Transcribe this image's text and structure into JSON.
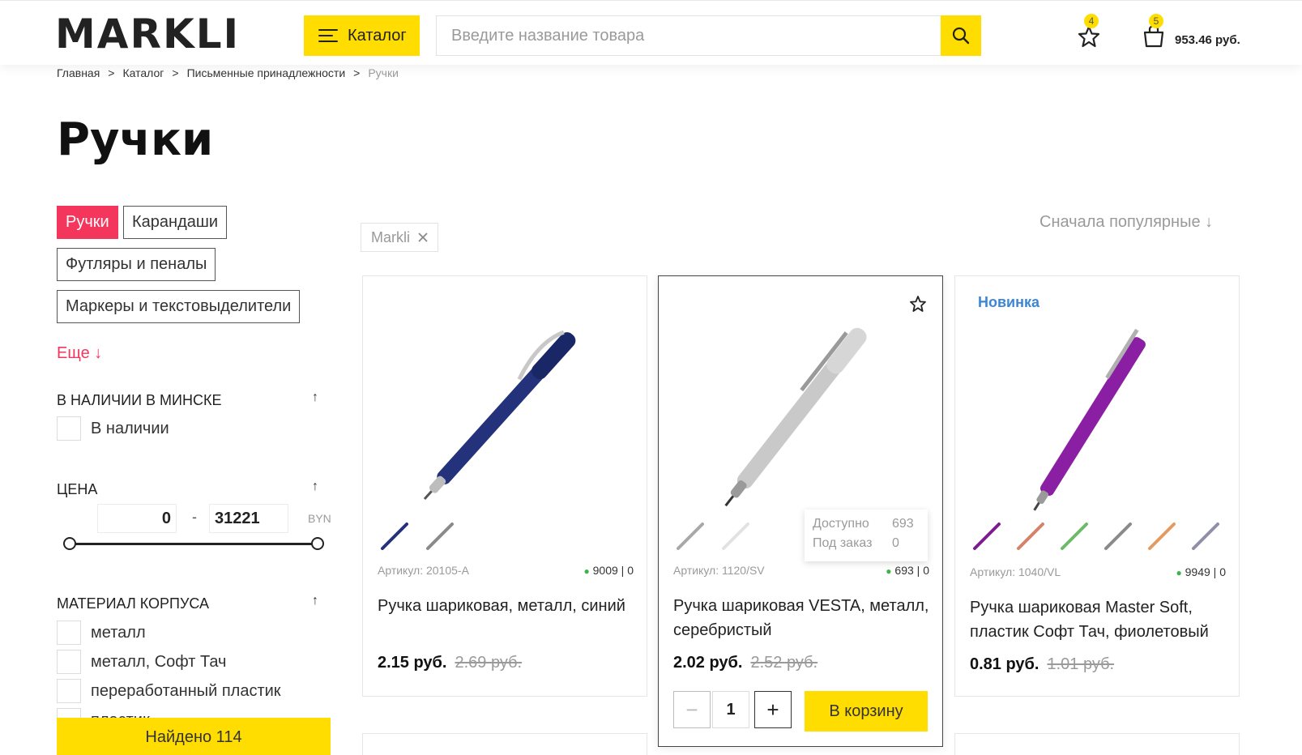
{
  "header": {
    "logo": "MARKLI",
    "catalog_label": "Каталог",
    "search_placeholder": "Введите название товара",
    "favorites_count": "4",
    "cart_count": "5",
    "cart_sum": "953.46 руб."
  },
  "breadcrumb": {
    "items": [
      "Главная",
      "Каталог",
      "Письменные принадлежности",
      "Ручки"
    ],
    "separator": ">"
  },
  "page_title": "Ручки",
  "subcategories": [
    "Ручки",
    "Карандаши",
    "Футляры и пеналы",
    "Маркеры и текстовыделители"
  ],
  "more_label": "Еще ↓",
  "filters": {
    "availability": {
      "title": "В НАЛИЧИИ В МИНСКЕ",
      "option": "В наличии"
    },
    "price": {
      "title": "ЦЕНА",
      "min": "0",
      "max": "31221",
      "currency": "BYN",
      "separator": "-"
    },
    "material": {
      "title": "МАТЕРИАЛ КОРПУСА",
      "options": [
        "металл",
        "металл, Софт Тач",
        "переработанный пластик",
        "пластик"
      ]
    },
    "arrow": "↑"
  },
  "found_label": "Найдено 114",
  "active_filter": "Markli",
  "sort_label": "Сначала популярные  ↓",
  "products": [
    {
      "sku": "Артикул: 20105-A",
      "stock": "9009",
      "order": "0",
      "name": "Ручка шариковая, металл, синий",
      "price": "2.15 руб.",
      "old_price": "2.69 руб.",
      "color": "#23327a",
      "swatches": [
        "#23327a",
        "#8a8a8a"
      ]
    },
    {
      "sku": "Артикул: 1120/SV",
      "stock": "693",
      "order": "0",
      "name": "Ручка шариковая VESTA, металл, серебристый",
      "price": "2.02 руб.",
      "old_price": "2.52 руб.",
      "color": "#c4c4c4",
      "swatches": [
        "#a8a8a8",
        "#e2e2e2"
      ],
      "tooltip": {
        "available_label": "Доступно",
        "available": "693",
        "order_label": "Под заказ",
        "order": "0"
      },
      "qty": "1",
      "to_cart_label": "В корзину"
    },
    {
      "badge": "Новинка",
      "sku": "Артикул: 1040/VL",
      "stock": "9949",
      "order": "0",
      "name": "Ручка шариковая Master Soft, пластик Софт Тач, фиолетовый",
      "price": "0.81 руб.",
      "old_price": "1.01 руб.",
      "color": "#8b1fa3",
      "swatches": [
        "#7c1d8f",
        "#d4826a",
        "#6cba6a",
        "#8a8a8a",
        "#e59a62",
        "#8f8fa8"
      ]
    }
  ],
  "colors": {
    "accent_yellow": "#ffdd00",
    "accent_pink": "#f5365c",
    "badge_blue": "#3d86d6"
  }
}
